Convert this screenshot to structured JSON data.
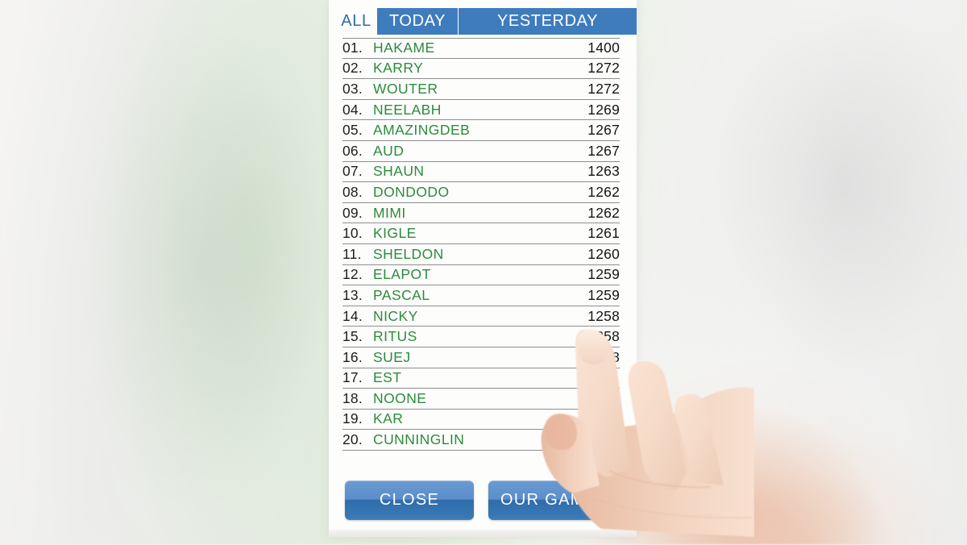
{
  "tabs": [
    {
      "label": "ALL",
      "active": false
    },
    {
      "label": "TODAY",
      "active": true
    },
    {
      "label": "YESTERDAY",
      "active": true
    }
  ],
  "colors": {
    "tab_active_bg": "#3f7cbe",
    "tab_inactive_text": "#2f6ca8",
    "player_name": "#2c8b3c",
    "score_text": "#141414",
    "button_top": "#6a9ad1",
    "button_bottom": "#2f6cab",
    "panel_bg": "#fdfdfc",
    "row_divider": "#8e8e8e"
  },
  "leaderboard": [
    {
      "rank": "01.",
      "name": "HAKAME",
      "score": "1400"
    },
    {
      "rank": "02.",
      "name": "KARRY",
      "score": "1272"
    },
    {
      "rank": "03.",
      "name": "WOUTER",
      "score": "1272"
    },
    {
      "rank": "04.",
      "name": "NEELABH",
      "score": "1269"
    },
    {
      "rank": "05.",
      "name": "AMAZINGDEB",
      "score": "1267"
    },
    {
      "rank": "06.",
      "name": "AUD",
      "score": "1267"
    },
    {
      "rank": "07.",
      "name": "SHAUN",
      "score": "1263"
    },
    {
      "rank": "08.",
      "name": "DONDODO",
      "score": "1262"
    },
    {
      "rank": "09.",
      "name": "MIMI",
      "score": "1262"
    },
    {
      "rank": "10.",
      "name": "KIGLE",
      "score": "1261"
    },
    {
      "rank": "11.",
      "name": "SHELDON",
      "score": "1260"
    },
    {
      "rank": "12.",
      "name": "ELAPOT",
      "score": "1259"
    },
    {
      "rank": "13.",
      "name": "PASCAL",
      "score": "1259"
    },
    {
      "rank": "14.",
      "name": "NICKY",
      "score": "1258"
    },
    {
      "rank": "15.",
      "name": "RITUS",
      "score": "1258"
    },
    {
      "rank": "16.",
      "name": "SUEJ",
      "score": "1258"
    },
    {
      "rank": "17.",
      "name": "EST",
      "score": ""
    },
    {
      "rank": "18.",
      "name": "NOONE",
      "score": ""
    },
    {
      "rank": "19.",
      "name": "KAR",
      "score": ""
    },
    {
      "rank": "20.",
      "name": "CUNNINGLIN",
      "score": ""
    }
  ],
  "buttons": {
    "close": "CLOSE",
    "our_games": "OUR GAMES"
  },
  "overlay": {
    "hand_icon": "pointing-hand"
  }
}
